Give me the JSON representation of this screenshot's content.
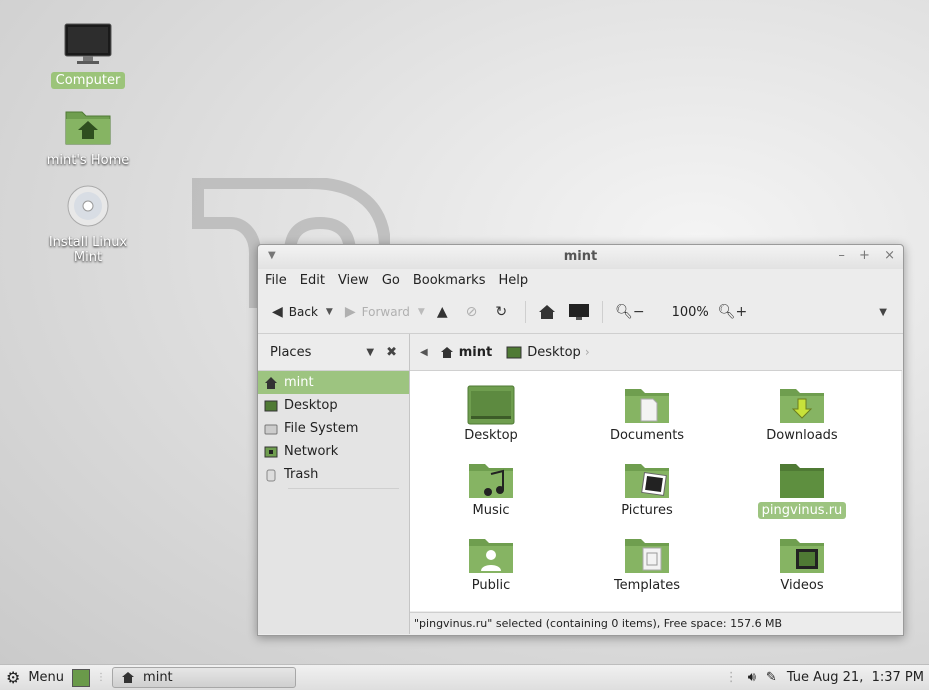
{
  "desktop": {
    "icons": [
      {
        "label": "Computer",
        "icon": "computer-icon",
        "selected": true
      },
      {
        "label": "mint's Home",
        "icon": "home-folder-icon",
        "selected": false
      },
      {
        "label": "Install Linux Mint",
        "icon": "cd-disc-icon",
        "selected": false
      }
    ]
  },
  "window": {
    "title": "mint",
    "menu": [
      "File",
      "Edit",
      "View",
      "Go",
      "Bookmarks",
      "Help"
    ],
    "toolbar": {
      "back": "Back",
      "forward": "Forward",
      "zoom": "100%"
    },
    "sidebar": {
      "header": "Places",
      "items": [
        "mint",
        "Desktop",
        "File System",
        "Network",
        "Trash"
      ]
    },
    "path": [
      "mint",
      "Desktop"
    ],
    "files": [
      "Desktop",
      "Documents",
      "Downloads",
      "Music",
      "Pictures",
      "pingvinus.ru",
      "Public",
      "Templates",
      "Videos"
    ],
    "status": "\"pingvinus.ru\" selected (containing 0 items), Free space: 157.6 MB"
  },
  "panel": {
    "menu_label": "Menu",
    "task_label": "mint",
    "clock": "Tue Aug 21,  1:37 PM"
  },
  "colors": {
    "accent": "#9dc480",
    "folder": "#6a9a4a"
  }
}
